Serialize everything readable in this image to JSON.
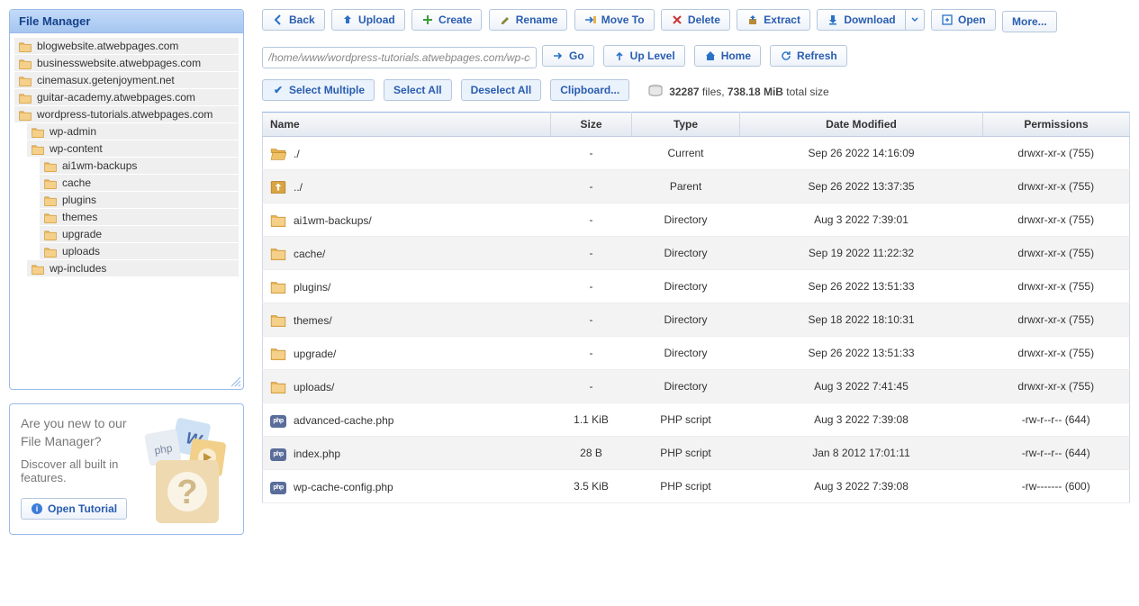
{
  "sidebar": {
    "title": "File Manager",
    "tree": [
      {
        "label": "blogwebsite.atwebpages.com",
        "indent": 0
      },
      {
        "label": "businesswebsite.atwebpages.com",
        "indent": 0
      },
      {
        "label": "cinemasux.getenjoyment.net",
        "indent": 0
      },
      {
        "label": "guitar-academy.atwebpages.com",
        "indent": 0
      },
      {
        "label": "wordpress-tutorials.atwebpages.com",
        "indent": 0
      },
      {
        "label": "wp-admin",
        "indent": 1
      },
      {
        "label": "wp-content",
        "indent": 1
      },
      {
        "label": "ai1wm-backups",
        "indent": 2
      },
      {
        "label": "cache",
        "indent": 2
      },
      {
        "label": "plugins",
        "indent": 2
      },
      {
        "label": "themes",
        "indent": 2
      },
      {
        "label": "upgrade",
        "indent": 2
      },
      {
        "label": "uploads",
        "indent": 2
      },
      {
        "label": "wp-includes",
        "indent": 1
      }
    ]
  },
  "help": {
    "line1": "Are you new to our File Manager?",
    "line2": "Discover all built in features.",
    "button": "Open Tutorial"
  },
  "toolbar": {
    "back": "Back",
    "upload": "Upload",
    "create": "Create",
    "rename": "Rename",
    "moveto": "Move To",
    "delete": "Delete",
    "extract": "Extract",
    "download": "Download",
    "open": "Open",
    "more": "More..."
  },
  "path": {
    "value": "/home/www/wordpress-tutorials.atwebpages.com/wp-content/",
    "go": "Go",
    "uplevel": "Up Level",
    "home": "Home",
    "refresh": "Refresh"
  },
  "select": {
    "multiple": "Select Multiple",
    "all": "Select All",
    "none": "Deselect All",
    "clip": "Clipboard..."
  },
  "stats": {
    "count": "32287",
    "count_suffix": " files, ",
    "size": "738.18 MiB",
    "size_suffix": " total size"
  },
  "columns": {
    "name": "Name",
    "size": "Size",
    "type": "Type",
    "date": "Date Modified",
    "perm": "Permissions"
  },
  "rows": [
    {
      "icon": "folder-open",
      "name": "./",
      "size": "-",
      "type": "Current",
      "date": "Sep 26 2022 14:16:09",
      "perm": "drwxr-xr-x (755)"
    },
    {
      "icon": "up",
      "name": "../",
      "size": "-",
      "type": "Parent",
      "date": "Sep 26 2022 13:37:35",
      "perm": "drwxr-xr-x (755)"
    },
    {
      "icon": "folder",
      "name": "ai1wm-backups/",
      "size": "-",
      "type": "Directory",
      "date": "Aug 3 2022 7:39:01",
      "perm": "drwxr-xr-x (755)"
    },
    {
      "icon": "folder",
      "name": "cache/",
      "size": "-",
      "type": "Directory",
      "date": "Sep 19 2022 11:22:32",
      "perm": "drwxr-xr-x (755)"
    },
    {
      "icon": "folder",
      "name": "plugins/",
      "size": "-",
      "type": "Directory",
      "date": "Sep 26 2022 13:51:33",
      "perm": "drwxr-xr-x (755)"
    },
    {
      "icon": "folder",
      "name": "themes/",
      "size": "-",
      "type": "Directory",
      "date": "Sep 18 2022 18:10:31",
      "perm": "drwxr-xr-x (755)"
    },
    {
      "icon": "folder",
      "name": "upgrade/",
      "size": "-",
      "type": "Directory",
      "date": "Sep 26 2022 13:51:33",
      "perm": "drwxr-xr-x (755)"
    },
    {
      "icon": "folder",
      "name": "uploads/",
      "size": "-",
      "type": "Directory",
      "date": "Aug 3 2022 7:41:45",
      "perm": "drwxr-xr-x (755)"
    },
    {
      "icon": "php",
      "name": "advanced-cache.php",
      "size": "1.1 KiB",
      "type": "PHP script",
      "date": "Aug 3 2022 7:39:08",
      "perm": "-rw-r--r-- (644)"
    },
    {
      "icon": "php",
      "name": "index.php",
      "size": "28 B",
      "type": "PHP script",
      "date": "Jan 8 2012 17:01:11",
      "perm": "-rw-r--r-- (644)"
    },
    {
      "icon": "php",
      "name": "wp-cache-config.php",
      "size": "3.5 KiB",
      "type": "PHP script",
      "date": "Aug 3 2022 7:39:08",
      "perm": "-rw------- (600)"
    }
  ]
}
